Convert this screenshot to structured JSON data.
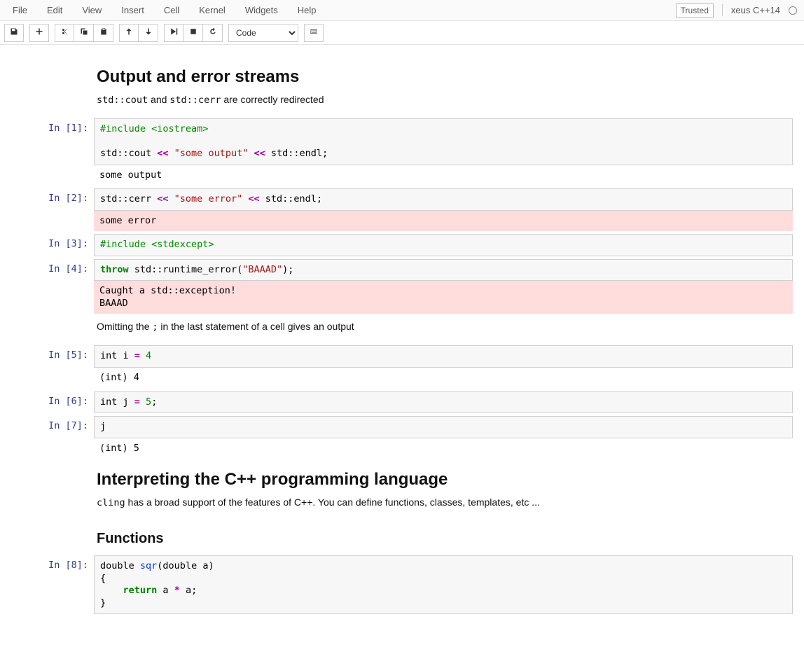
{
  "menubar": {
    "items": [
      "File",
      "Edit",
      "View",
      "Insert",
      "Cell",
      "Kernel",
      "Widgets",
      "Help"
    ],
    "trusted": "Trusted",
    "kernel": "xeus C++14"
  },
  "toolbar": {
    "cell_type": "Code"
  },
  "md1": {
    "heading": "Output and error streams",
    "p_prefix": "std::cout",
    "p_mid": " and ",
    "p_suffix": "std::cerr",
    "p_tail": " are correctly redirected"
  },
  "cells": {
    "c1": {
      "prompt": "In [1]:",
      "pp": "#include <iostream>",
      "l2a": "std::cout ",
      "l2op": "<<",
      "l2s": " \"some output\" ",
      "l2b": " std::endl;",
      "out": "some output"
    },
    "c2": {
      "prompt": "In [2]:",
      "a": "std::cerr ",
      "op": "<<",
      "s": " \"some error\" ",
      "b": " std::endl;",
      "err": "some error"
    },
    "c3": {
      "prompt": "In [3]:",
      "pp": "#include <stdexcept>"
    },
    "c4": {
      "prompt": "In [4]:",
      "kw": "throw",
      "a": " std::runtime_error(",
      "s": "\"BAAAD\"",
      "b": ");",
      "err": "Caught a std::exception!\nBAAAD"
    },
    "c5": {
      "prompt": "In [5]:",
      "a": "int i ",
      "op": "=",
      "n": " 4",
      "out": "(int) 4"
    },
    "c6": {
      "prompt": "In [6]:",
      "a": "int j ",
      "op": "=",
      "n": " 5",
      "b": ";"
    },
    "c7": {
      "prompt": "In [7]:",
      "a": "j",
      "out": "(int) 5"
    },
    "c8": {
      "prompt": "In [8]:",
      "l1a": "double ",
      "l1fn": "sqr",
      "l1b": "(double a)",
      "l2": "{",
      "l3sp": "    ",
      "l3kw": "return",
      "l3a": " a ",
      "l3op": "*",
      "l3b": " a;",
      "l4": "}"
    }
  },
  "md2": {
    "p_prefix": "Omitting the ",
    "code": ";",
    "p_suffix": " in the last statement of a cell gives an output"
  },
  "md3": {
    "heading": "Interpreting the C++ programming language",
    "code": "cling",
    "p": " has a broad support of the features of C++. You can define functions, classes, templates, etc ..."
  },
  "md4": {
    "heading": "Functions"
  }
}
